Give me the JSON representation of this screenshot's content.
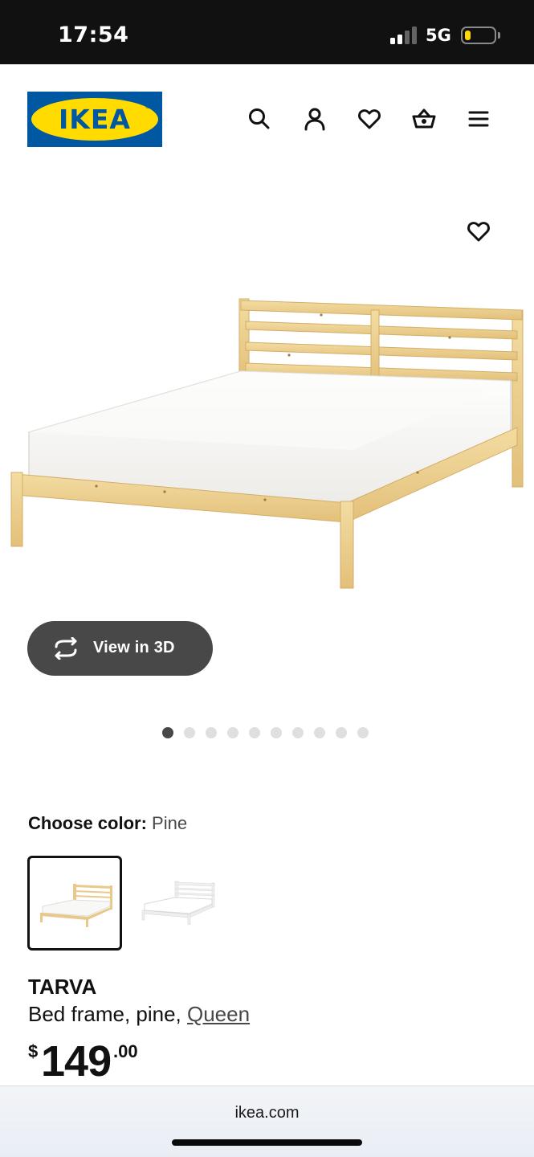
{
  "status_bar": {
    "time": "17:54",
    "network": "5G",
    "signal_bars_active": 2,
    "signal_bars_total": 4,
    "battery_level": 0.22
  },
  "header": {
    "logo_text": "IKEA",
    "logo_mark": "®",
    "icons": [
      "search-icon",
      "account-icon",
      "heart-icon",
      "basket-icon",
      "menu-icon"
    ]
  },
  "gallery": {
    "view_3d_label": "View in 3D",
    "image_count": 10,
    "active_image": 0
  },
  "color_choice": {
    "label": "Choose color:",
    "selected_value": "Pine",
    "options": [
      "pine",
      "white"
    ]
  },
  "product": {
    "name": "TARVA",
    "description": "Bed frame, pine, ",
    "size_link": "Queen",
    "price_currency": "$",
    "price_integer": "149",
    "price_decimal": ".00"
  },
  "browser": {
    "url": "ikea.com"
  },
  "colors": {
    "ikea_blue": "#0058a3",
    "ikea_yellow": "#ffdb00",
    "button_dark": "#484848"
  }
}
